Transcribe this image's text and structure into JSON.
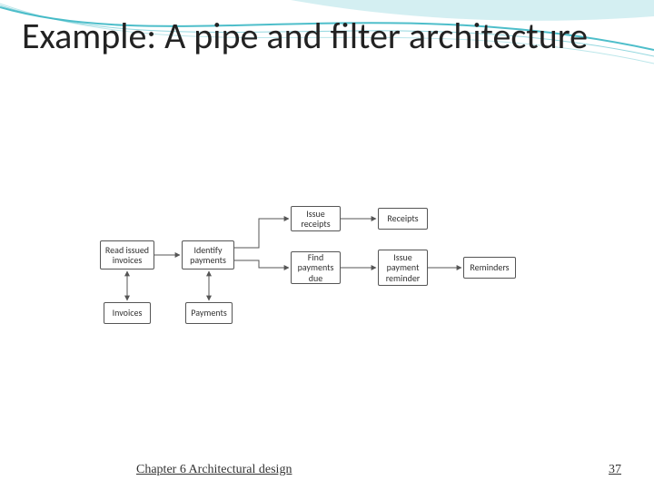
{
  "title": "Example: A pipe and filter architecture",
  "footer": {
    "chapter": "Chapter 6 Architectural design",
    "page": "37"
  },
  "nodes": {
    "read_issued_invoices": "Read issued invoices",
    "identify_payments": "Identify payments",
    "issue_receipts": "Issue receipts",
    "receipts": "Receipts",
    "find_payments_due": "Find payments due",
    "issue_payment_reminder": "Issue payment reminder",
    "reminders": "Reminders",
    "invoices": "Invoices",
    "payments": "Payments"
  },
  "colors": {
    "swoosh": "#3bb7c4",
    "text": "#222"
  }
}
